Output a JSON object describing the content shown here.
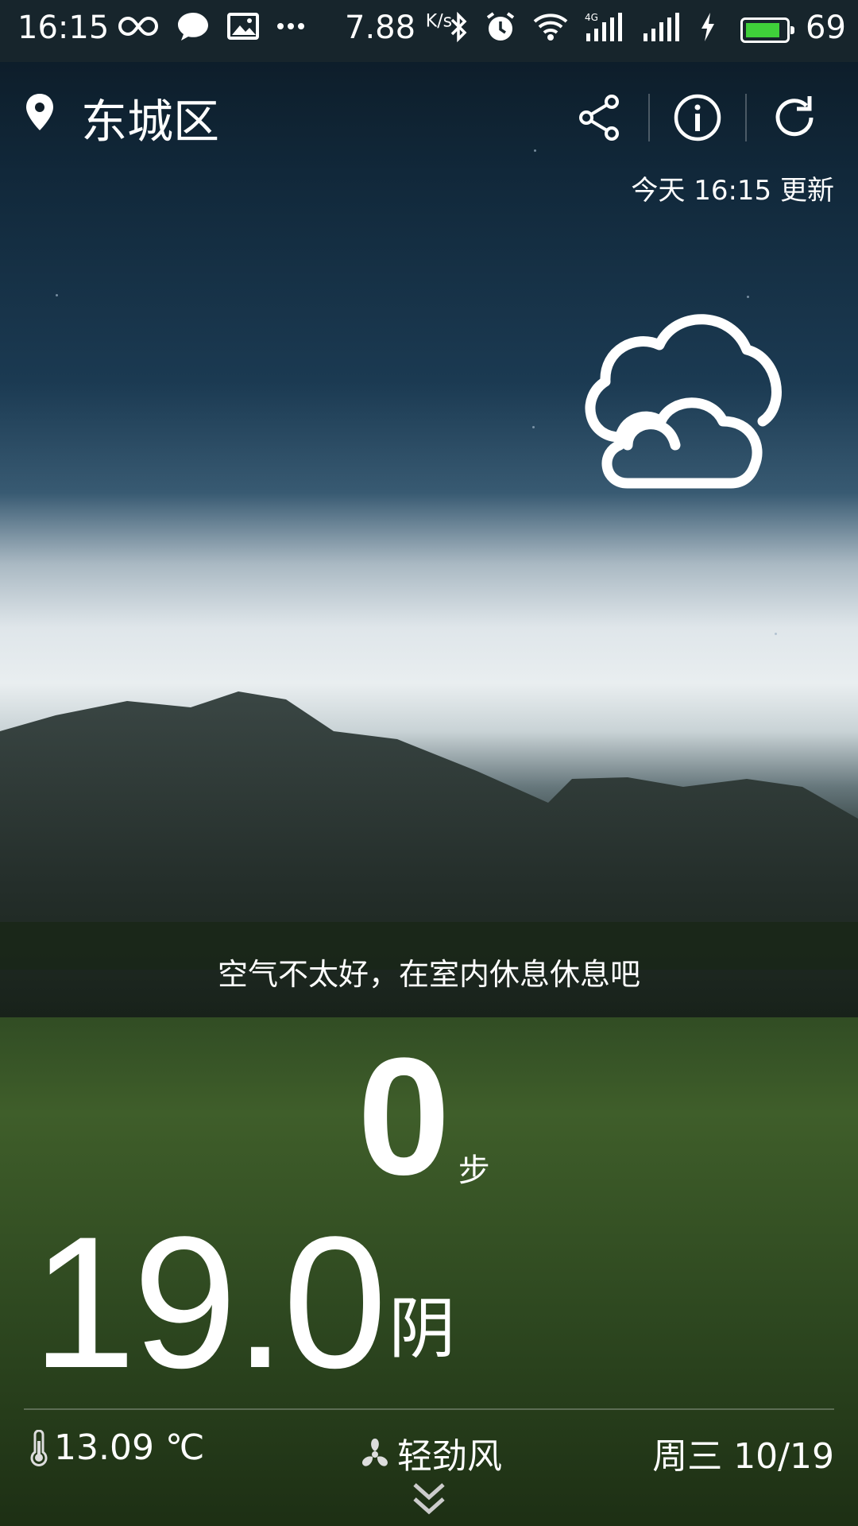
{
  "status_bar": {
    "time": "16:15",
    "net_speed": "7.88",
    "net_speed_unit": "K/s",
    "battery_percent": "69",
    "icons": [
      "infinity-icon",
      "message-icon",
      "image-icon",
      "more-icon",
      "bluetooth-icon",
      "alarm-icon",
      "wifi-icon",
      "signal-4g-icon",
      "signal-icon",
      "charging-icon",
      "battery-icon"
    ],
    "battery_color": "#3fd03a"
  },
  "header": {
    "location": "东城区",
    "update_time": "今天 16:15 更新",
    "actions": [
      "share-icon",
      "info-icon",
      "refresh-icon"
    ]
  },
  "weather": {
    "icon": "cloudy-icon",
    "tip": "空气不太好，在室内休息休息吧",
    "steps": "0",
    "steps_unit": "步",
    "temperature": "19.0",
    "condition": "阴",
    "feels_like": "13.09 ℃",
    "wind": "轻劲风",
    "date": "周三 10/19"
  }
}
